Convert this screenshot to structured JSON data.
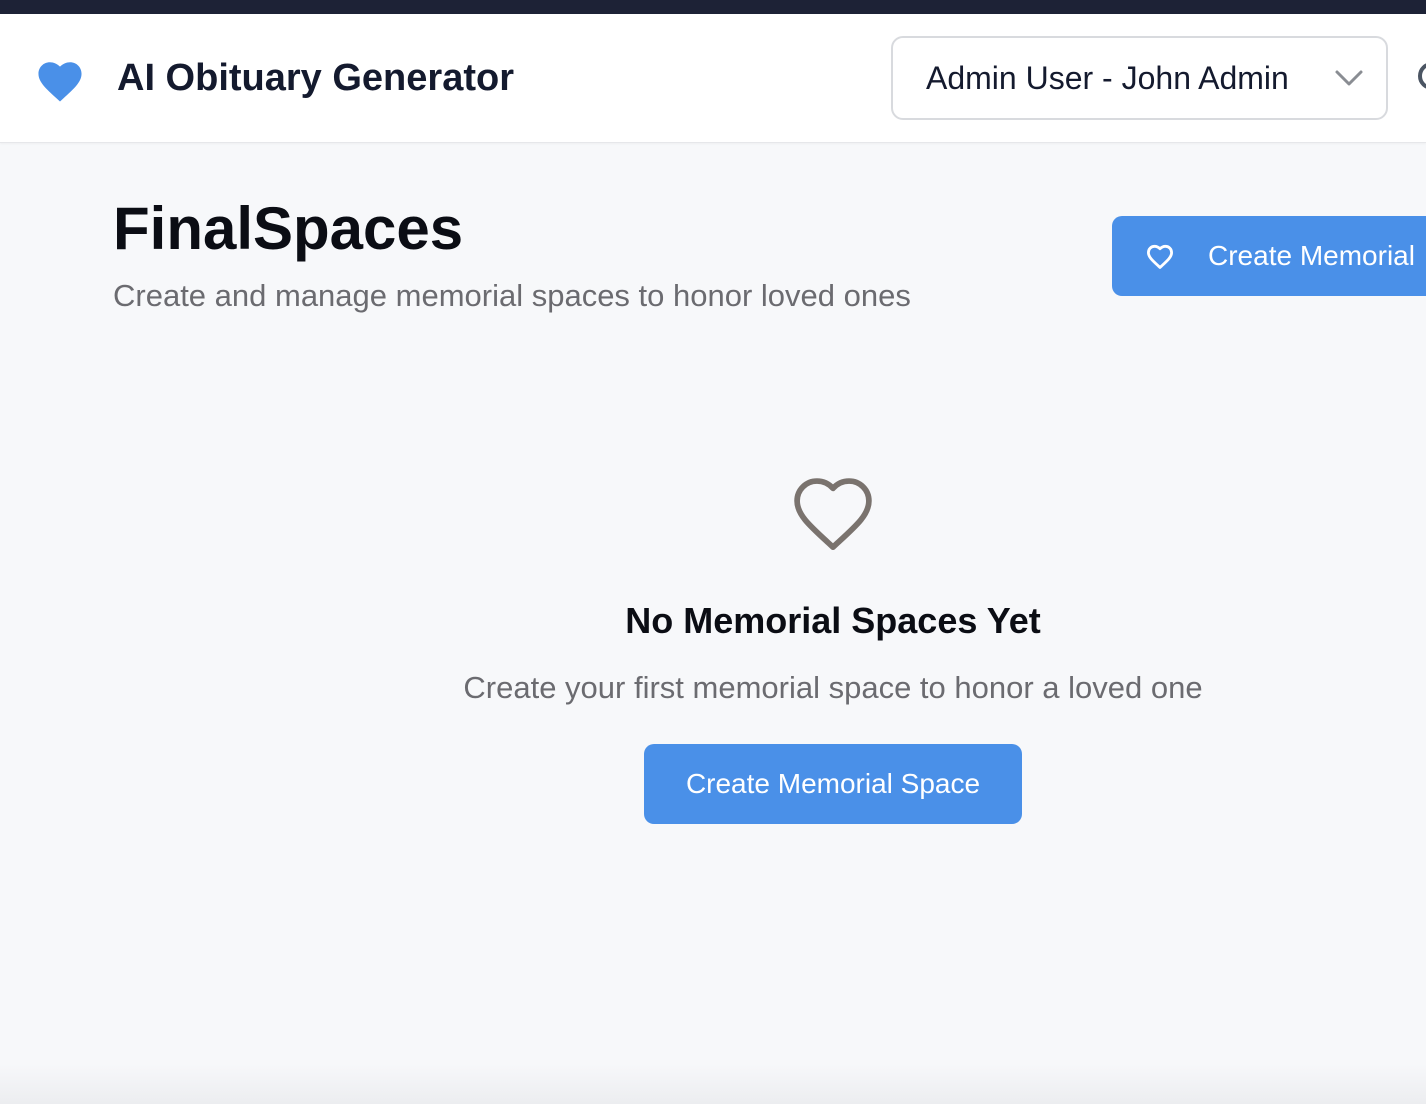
{
  "colors": {
    "accent": "#4a90e8",
    "top_strip": "#1d2236",
    "page_background": "#f7f8fa",
    "heading_text": "#0b0d14",
    "muted_text": "#6b6b70",
    "empty_icon_stroke": "#7a736e"
  },
  "header": {
    "brand_icon": "heart-icon",
    "title": "AI Obituary Generator",
    "user_selector": {
      "selected_value": "Admin User - John Admin",
      "icon": "chevron-down-icon"
    }
  },
  "main": {
    "title": "FinalSpaces",
    "subtitle": "Create and manage memorial spaces to honor loved ones",
    "create_button": {
      "icon": "heart-outline-icon",
      "label": "Create Memorial"
    },
    "empty_state": {
      "icon": "heart-outline-icon",
      "title": "No Memorial Spaces Yet",
      "text": "Create your first memorial space to honor a loved one",
      "button_label": "Create Memorial Space"
    }
  }
}
